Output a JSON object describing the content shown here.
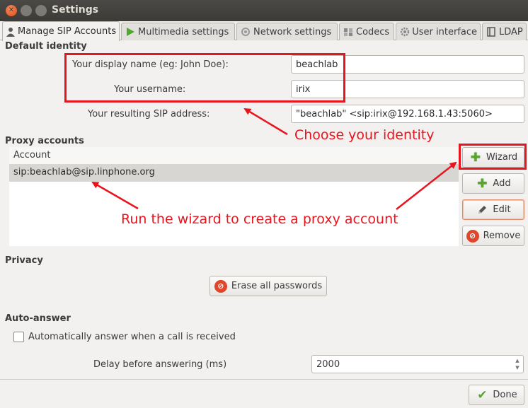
{
  "window": {
    "title": "Settings"
  },
  "tabs": [
    {
      "label": "Manage SIP Accounts",
      "icon": "user-icon",
      "active": true
    },
    {
      "label": "Multimedia settings",
      "icon": "play-icon",
      "active": false
    },
    {
      "label": "Network settings",
      "icon": "network-icon",
      "active": false
    },
    {
      "label": "Codecs",
      "icon": "codecs-icon",
      "active": false
    },
    {
      "label": "User interface",
      "icon": "gear-icon",
      "active": false
    },
    {
      "label": "LDAP",
      "icon": "book-icon",
      "active": false
    }
  ],
  "identity": {
    "section_title": "Default identity",
    "display_name_label": "Your display name (eg: John Doe):",
    "display_name_value": "beachlab",
    "username_label": "Your username:",
    "username_value": "irix",
    "sip_label": "Your resulting SIP address:",
    "sip_value": "\"beachlab\" <sip:irix@192.168.1.43:5060>"
  },
  "proxy": {
    "section_title": "Proxy accounts",
    "column_header": "Account",
    "rows": [
      "sip:beachlab@sip.linphone.org"
    ],
    "buttons": {
      "wizard": "Wizard",
      "add": "Add",
      "edit": "Edit",
      "remove": "Remove"
    }
  },
  "privacy": {
    "section_title": "Privacy",
    "erase_button": "Erase all passwords"
  },
  "auto_answer": {
    "section_title": "Auto-answer",
    "checkbox_label": "Automatically answer when a call is received",
    "checked": false,
    "delay_label": "Delay before answering (ms)",
    "delay_value": "2000"
  },
  "footer": {
    "done_button": "Done"
  },
  "annotations": {
    "identity_note": "Choose your identity",
    "wizard_note": "Run the wizard to create a proxy account",
    "color": "#e8141e"
  }
}
